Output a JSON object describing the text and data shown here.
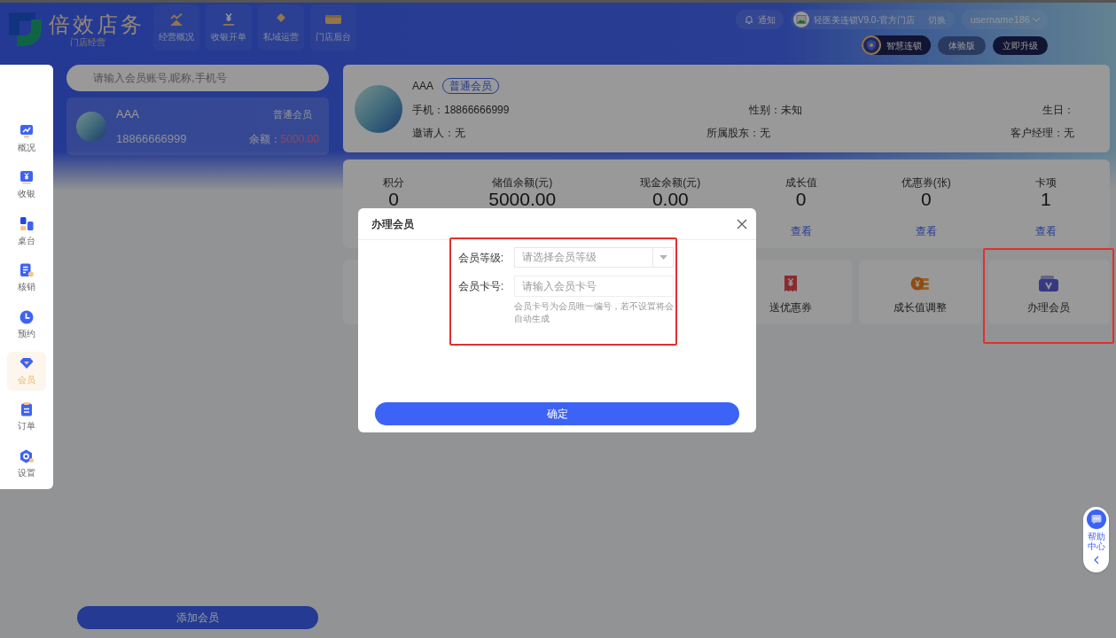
{
  "header": {
    "logo": {
      "title": "倍效店务",
      "tagline": "门店经营"
    },
    "nav": [
      {
        "label": "经营概况"
      },
      {
        "label": "收银开单"
      },
      {
        "label": "私域运营"
      },
      {
        "label": "门店后台"
      }
    ],
    "notice": "通知",
    "store": {
      "name": "轻医美连锁V9.0-官方门店",
      "switch": "切换"
    },
    "user": "username186",
    "chain": "智慧连锁",
    "edition": "体验版",
    "upgrade": "立即升级"
  },
  "sidebar": {
    "items": [
      {
        "label": "概况",
        "selected": false
      },
      {
        "label": "收银",
        "selected": false
      },
      {
        "label": "桌台",
        "selected": false
      },
      {
        "label": "核销",
        "selected": false
      },
      {
        "label": "预约",
        "selected": false
      },
      {
        "label": "会员",
        "selected": true
      },
      {
        "label": "订单",
        "selected": false
      },
      {
        "label": "设置",
        "selected": false
      }
    ]
  },
  "member_list": {
    "search": {
      "placeholder": "请输入会员账号,昵称,手机号"
    },
    "members": [
      {
        "name": "AAA",
        "tier": "普通会员",
        "phone": "18866666999",
        "balance_label": "余额：",
        "balance": "5000.00",
        "selected": true
      }
    ],
    "add_button": "添加会员"
  },
  "member": {
    "name": "AAA",
    "tier": "普通会员",
    "rows": [
      [
        "手机：18866666999",
        "性别：未知",
        "生日："
      ],
      [
        "邀请人：无",
        "所属股东：无",
        "客户经理：无"
      ]
    ]
  },
  "stats": [
    {
      "label": "积分",
      "value": "0"
    },
    {
      "label": "储值余额(元)",
      "value": "5000.00"
    },
    {
      "label": "现金余额(元)",
      "value": "0.00"
    },
    {
      "label": "成长值",
      "value": "0",
      "link": "查看"
    },
    {
      "label": "优惠券(张)",
      "value": "0",
      "link": "查看"
    },
    {
      "label": "卡项",
      "value": "1",
      "link": "查看"
    }
  ],
  "actions": [
    {
      "label": "送优惠券",
      "highlighted": false
    },
    {
      "label": "成长值调整",
      "highlighted": false
    },
    {
      "label": "办理会员",
      "highlighted": true
    }
  ],
  "modal": {
    "title": "办理会员",
    "highlighted": true,
    "fields": [
      {
        "kind": "select",
        "label": "会员等级:",
        "placeholder": "请选择会员等级"
      },
      {
        "kind": "input",
        "label": "会员卡号:",
        "placeholder": "请输入会员卡号",
        "hint": "会员卡号为会员唯一编号，若不设置将会自动生成"
      }
    ],
    "confirm": "确定"
  },
  "help": {
    "label": "帮助中心"
  }
}
